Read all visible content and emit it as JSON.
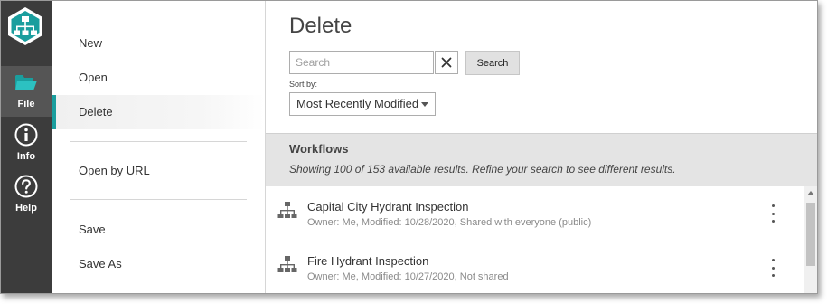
{
  "rail": {
    "items": [
      {
        "label": "File",
        "icon": "folder-icon"
      },
      {
        "label": "Info",
        "icon": "info-icon"
      },
      {
        "label": "Help",
        "icon": "help-icon"
      }
    ],
    "accent": "#1a9e9e"
  },
  "file_menu": {
    "items": [
      "New",
      "Open",
      "Delete",
      "Open by URL",
      "Save",
      "Save As"
    ],
    "active": "Delete"
  },
  "main": {
    "title": "Delete",
    "search": {
      "placeholder": "Search",
      "button_label": "Search",
      "clear_icon": "close-icon"
    },
    "sort": {
      "label": "Sort by:",
      "selected": "Most Recently Modified"
    },
    "results": {
      "heading": "Workflows",
      "summary": "Showing 100 of 153 available results. Refine your search to see different results.",
      "items": [
        {
          "name": "Capital City Hydrant Inspection",
          "meta": "Owner: Me, Modified: 10/28/2020, Shared with everyone (public)"
        },
        {
          "name": "Fire Hydrant Inspection",
          "meta": "Owner: Me, Modified: 10/27/2020, Not shared"
        }
      ]
    }
  }
}
